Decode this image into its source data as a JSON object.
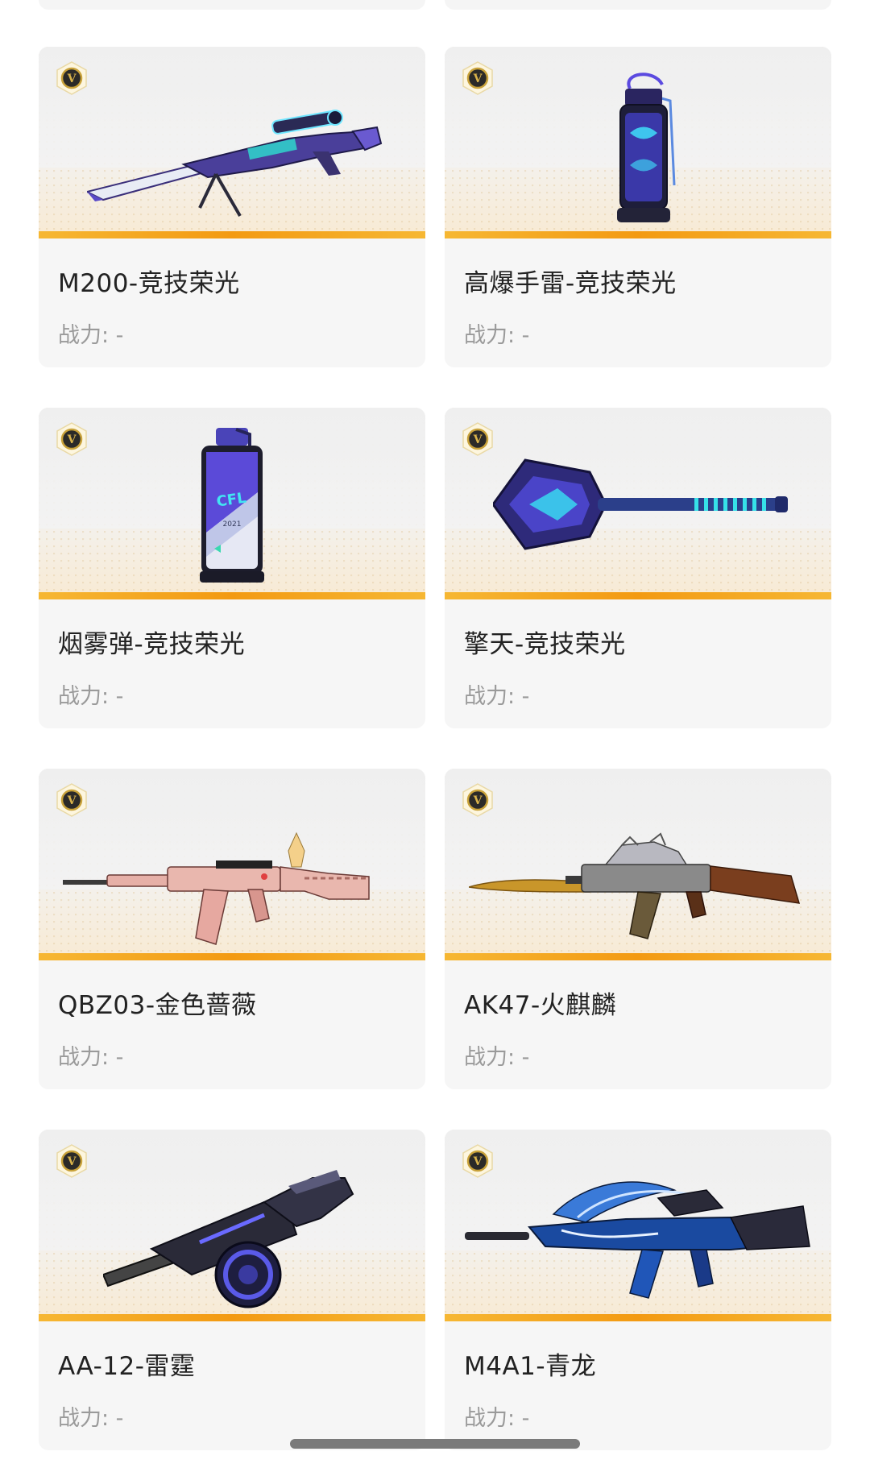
{
  "cards": [
    {
      "name": "M200-竞技荣光",
      "power": "战力: -",
      "badge": "V",
      "weapon_icon": "sniper-rifle-icon"
    },
    {
      "name": "高爆手雷-竞技荣光",
      "power": "战力: -",
      "badge": "V",
      "weapon_icon": "grenade-icon"
    },
    {
      "name": "烟雾弹-竞技荣光",
      "power": "战力: -",
      "badge": "V",
      "weapon_icon": "smoke-grenade-icon",
      "canister_label": "2021"
    },
    {
      "name": "擎天-竞技荣光",
      "power": "战力: -",
      "badge": "V",
      "weapon_icon": "shovel-melee-icon"
    },
    {
      "name": "QBZ03-金色蔷薇",
      "power": "战力: -",
      "badge": "V",
      "weapon_icon": "assault-rifle-pink-icon"
    },
    {
      "name": "AK47-火麒麟",
      "power": "战力: -",
      "badge": "V",
      "weapon_icon": "ak47-golden-icon"
    },
    {
      "name": "AA-12-雷霆",
      "power": "战力: -",
      "badge": "V",
      "weapon_icon": "drum-shotgun-icon"
    },
    {
      "name": "M4A1-青龙",
      "power": "战力: -",
      "badge": "V",
      "weapon_icon": "m4a1-dragon-icon"
    }
  ],
  "colors": {
    "accent_bar": "#f39a12",
    "badge_gold": "#c9a23a",
    "card_bg": "#f6f6f6",
    "name_text": "#222222",
    "power_text": "#9a9a9a"
  }
}
